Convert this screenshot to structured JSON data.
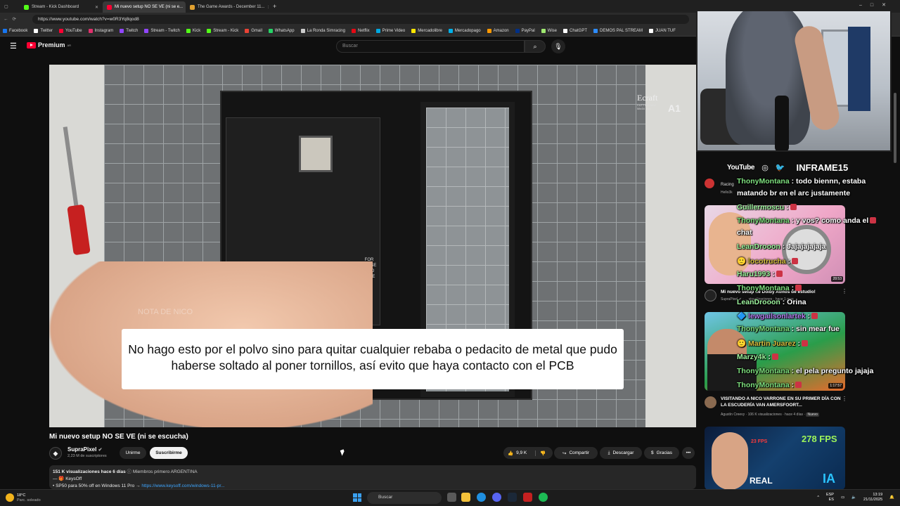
{
  "browser": {
    "tabs": [
      {
        "title": "Stream - Kick Dashboard",
        "color": "#53fc18"
      },
      {
        "title": "Mi nuevo setup NO SE VE (ni se e...",
        "color": "#ff0033"
      },
      {
        "title": "The Game Awards - December 11...",
        "color": "#e0a030"
      }
    ],
    "url": "https://www.youtube.com/watch?v=w0R3Yq8qod8",
    "bookmarks": [
      {
        "label": "Facebook",
        "color": "#1877f2"
      },
      {
        "label": "Twitter",
        "color": "#ffffff"
      },
      {
        "label": "YouTube",
        "color": "#ff0033"
      },
      {
        "label": "Instagram",
        "color": "#e1306c"
      },
      {
        "label": "Twitch",
        "color": "#9146ff"
      },
      {
        "label": "Stream - Twitch",
        "color": "#9146ff"
      },
      {
        "label": "Kick",
        "color": "#53fc18"
      },
      {
        "label": "Stream - Kick",
        "color": "#53fc18"
      },
      {
        "label": "Gmail",
        "color": "#ea4335"
      },
      {
        "label": "WhatsApp",
        "color": "#25d366"
      },
      {
        "label": "La Ronda Simracing",
        "color": "#cccccc"
      },
      {
        "label": "Netflix",
        "color": "#e50914"
      },
      {
        "label": "Prime Video",
        "color": "#00a8e1"
      },
      {
        "label": "Mercadolibre",
        "color": "#ffe600"
      },
      {
        "label": "Mercadopago",
        "color": "#00b1ea"
      },
      {
        "label": "Amazon",
        "color": "#ff9900"
      },
      {
        "label": "PayPal",
        "color": "#003087"
      },
      {
        "label": "Wise",
        "color": "#9fe870"
      },
      {
        "label": "ChatGPT",
        "color": "#ffffff"
      },
      {
        "label": "DEMOS PAL STREAM",
        "color": "#2d8cff"
      },
      {
        "label": "JUAN TUF",
        "color": "#ffffff"
      }
    ]
  },
  "youtube": {
    "logo_text": "Premium",
    "logo_sup": "AR",
    "search_placeholder": "Buscar",
    "video": {
      "subtitle": "No hago esto por el polvo sino para quitar cualquier rebaba o pedacito de metal que pudo haberse soltado al poner tornillos, así evito que haya contacto con el PCB",
      "watermark": "NOTA DE NICO",
      "ecraft": "Ecraft",
      "ecraft_small": "CUTTING MAT\n58x34 inch",
      "ecraft_size": "A1",
      "gpu_text": "FOR\nTHOSE\nWHO\nDARE"
    },
    "title": "Mi nuevo setup NO SE VE (ni se escucha)",
    "channel": {
      "name": "SupraPixel",
      "subs": "2,23 M de suscriptores",
      "verified": "✔"
    },
    "buttons": {
      "join": "Unirme",
      "subscribe": "Suscribirme",
      "likes": "9,9 K",
      "share": "Compartir",
      "download": "Descargar",
      "thanks": "Gracias",
      "more": "•••"
    },
    "description": {
      "meta": "151 K visualizaciones  hace 6 días",
      "meta_extra": "  ⓘ Miembros primero  ARGENTINA",
      "line2": "—  🎁 KeysOff",
      "line3": "•  SP50 para 50% off en Windows 11 Pro →",
      "link": "https://www.keysoff.com/windows-11-pr..."
    }
  },
  "overlay": {
    "social_youtube": "YouTube",
    "channel_name": "INFRAME15"
  },
  "recommended": [
    {
      "partial_meta": "Racing",
      "partial_meta2": "Hello3k"
    },
    {
      "title": "Mi nuevo setup de Dolby Atmos de estudio!",
      "meta": "SupraPixel ✔ · ... visualizaciones · hace 1 mes",
      "duration": "28:53"
    },
    {
      "title": "VISITANDO A NICO VARRONE EN SU PRIMER DÍA CON LA ESCUDERÍA VAN AMERSFOORT...",
      "meta": "Agustín Creevy · 106 K visualizaciones · hace 4 días",
      "badge": "Nuevo",
      "duration": "1:17:57"
    },
    {
      "overlay_fps": "278 FPS",
      "overlay_fps2": "23 FPS",
      "overlay_text": "REAL"
    }
  ],
  "chat": [
    {
      "user": "ThonyMontana",
      "text": " : todo biennn, estaba",
      "cls": "u1"
    },
    {
      "user": "",
      "text": "matando br en el arc justamente",
      "cls": ""
    },
    {
      "user": "Guillermoscu",
      "text": " :",
      "cls": "u2",
      "badge": true
    },
    {
      "user": "ThonyMontana",
      "text": " : y vos? como anda el",
      "cls": "u1",
      "badge": true
    },
    {
      "user": "",
      "text": "chat",
      "cls": ""
    },
    {
      "user": "LeanDrooon",
      "text": " : Jajajajajaja",
      "cls": "u2"
    },
    {
      "user": "🙂 locotrucha",
      "text": " :",
      "cls": "u3",
      "badge": true
    },
    {
      "user": "Haru1993",
      "text": " :",
      "cls": "u2",
      "badge": true
    },
    {
      "user": "ThonyMontana",
      "text": " :",
      "cls": "u1",
      "badge": true
    },
    {
      "user": "LeanDrooon",
      "text": " : Orina",
      "cls": "u2"
    },
    {
      "user": "🔷 lewgailsonlartek",
      "text": " :",
      "cls": "u4",
      "badge": true
    },
    {
      "user": "ThonyMontana",
      "text": " : sin mear fue",
      "cls": "u1"
    },
    {
      "user": "🙂 Martin Juarez",
      "text": " :",
      "cls": "u3",
      "badge": true
    },
    {
      "user": "Marzy4k",
      "text": " :",
      "cls": "u2",
      "badge": true
    },
    {
      "user": "ThonyMontana",
      "text": " : el pela pregunto jajaja",
      "cls": "u1"
    },
    {
      "user": "ThonyMontana",
      "text": " :",
      "cls": "u1",
      "badge": true
    }
  ],
  "taskbar": {
    "weather_temp": "18°C",
    "weather_desc": "Parc. soleado",
    "search": "Buscar",
    "lang1": "ESP",
    "lang2": "ES",
    "time": "13:19",
    "date": "21/11/2025"
  }
}
